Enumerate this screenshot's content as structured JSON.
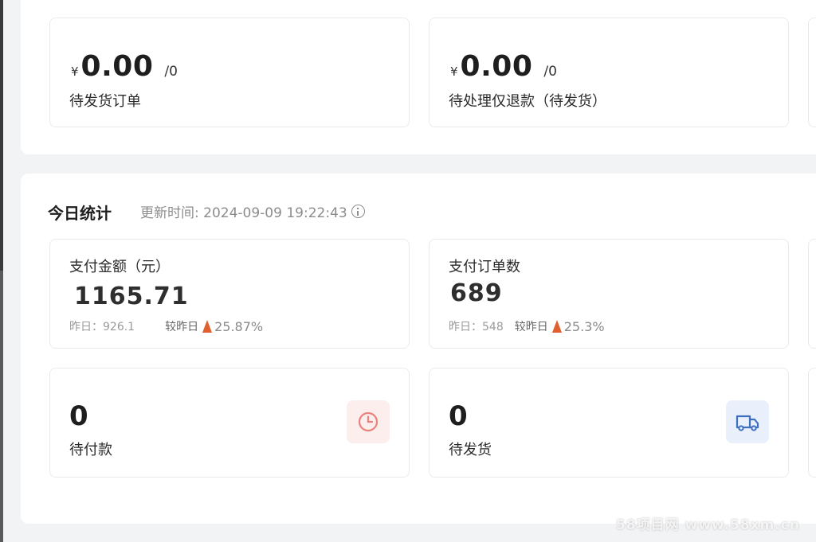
{
  "pending": {
    "cards": [
      {
        "currency": "¥",
        "amount": "0.00",
        "count": "/0",
        "label": "待发货订单"
      },
      {
        "currency": "¥",
        "amount": "0.00",
        "count": "/0",
        "label": "待处理仅退款（待发货）"
      }
    ]
  },
  "today": {
    "title": "今日统计",
    "update_label": "更新时间: 2024-09-09 19:22:43",
    "info_icon": "info-circle-icon",
    "stats": [
      {
        "title": "支付金额（元）",
        "value": "1165.71",
        "yesterday": "昨日：926.1",
        "compare_label": "较昨日",
        "percent": "25.87%",
        "trend_icon": "up-arrow-icon"
      },
      {
        "title": "支付订单数",
        "value": "689",
        "yesterday": "昨日：548",
        "compare_label": "较昨日",
        "percent": "25.3%",
        "trend_icon": "up-arrow-icon"
      }
    ],
    "todo": [
      {
        "value": "0",
        "label": "待付款",
        "icon": "clock-icon",
        "icon_color": "#e9827b"
      },
      {
        "value": "0",
        "label": "待发货",
        "icon": "truck-icon",
        "icon_color": "#3f6fbf"
      }
    ]
  },
  "watermark": "58项目网 www.58xm.cn",
  "colors": {
    "trend_up": "#e0602f",
    "background": "#f2f3f5"
  }
}
